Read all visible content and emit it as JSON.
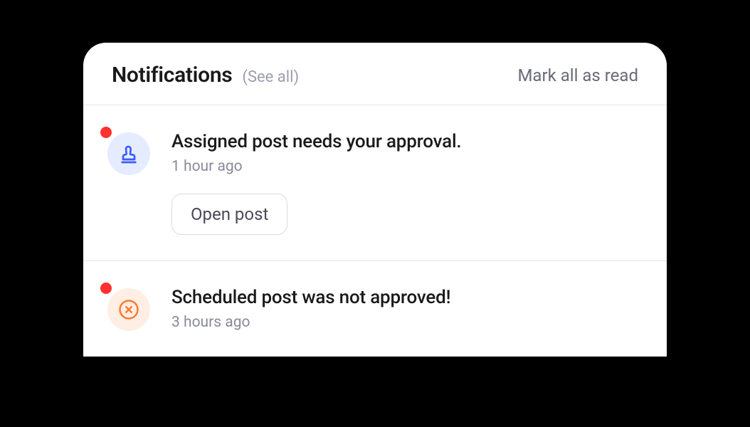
{
  "header": {
    "title": "Notifications",
    "see_all": "(See all)",
    "mark_all_read": "Mark all as read"
  },
  "notifications": [
    {
      "icon": "stamp-icon",
      "icon_bg": "blue",
      "unread": true,
      "title": "Assigned post needs your approval.",
      "time": "1 hour ago",
      "action_label": "Open post"
    },
    {
      "icon": "x-circle-icon",
      "icon_bg": "orange",
      "unread": true,
      "title": "Scheduled post was not approved!",
      "time": "3 hours ago"
    }
  ]
}
